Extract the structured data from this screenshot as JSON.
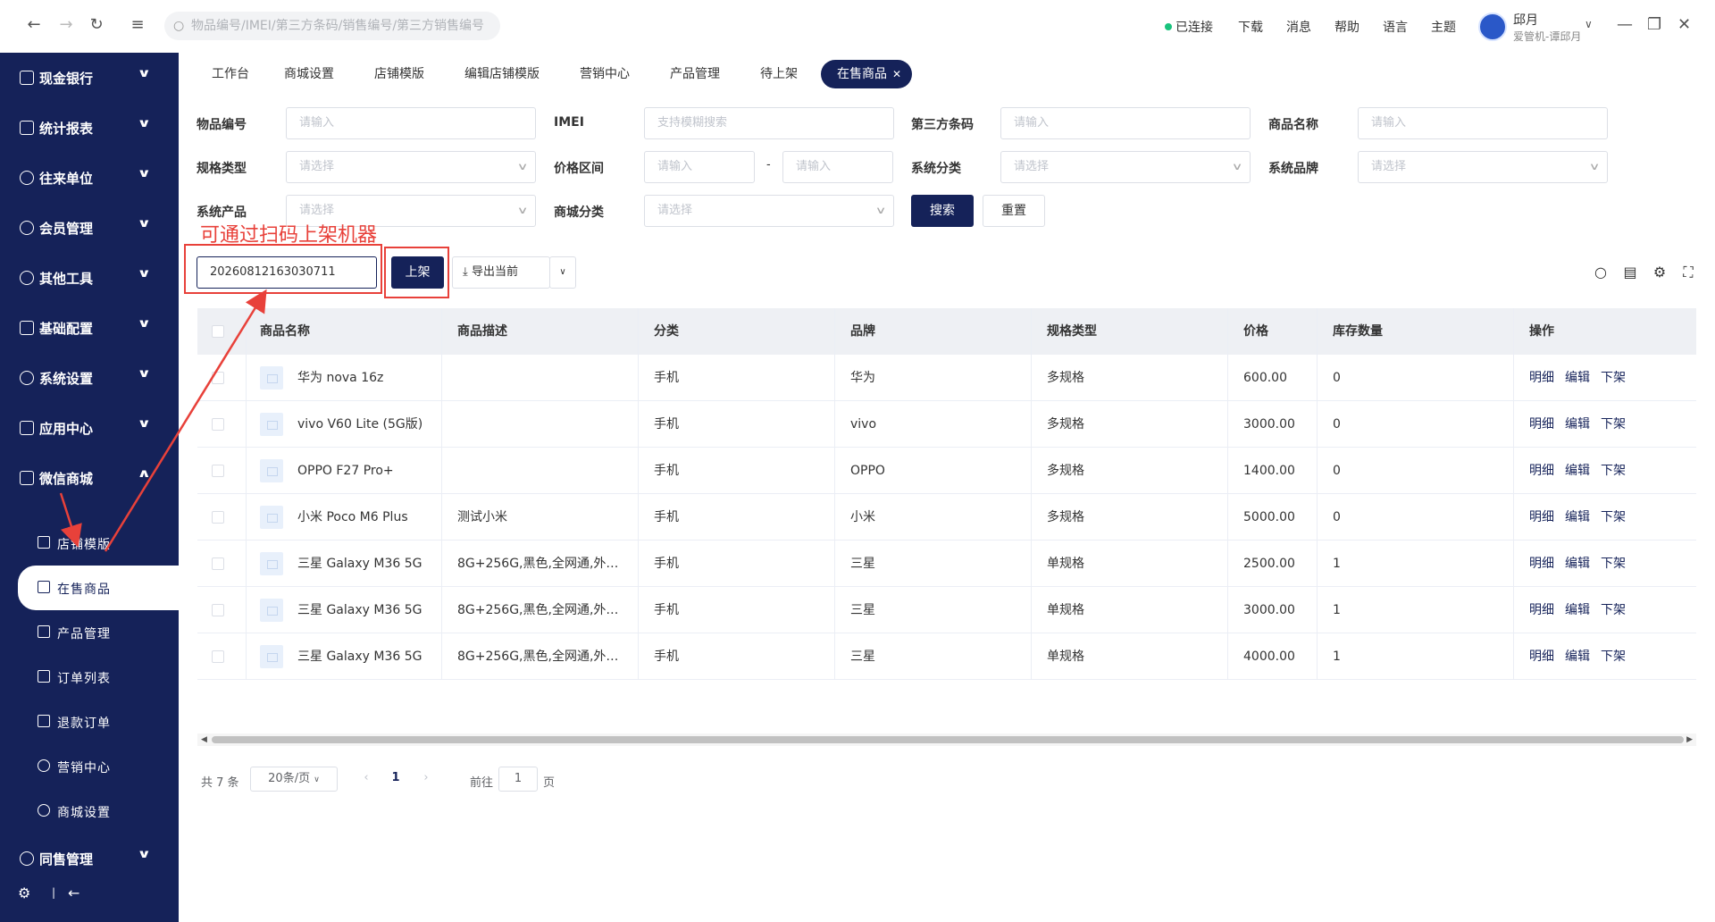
{
  "topbar": {
    "search_placeholder": "物品编号/IMEI/第三方条码/销售编号/第三方销售编号",
    "status": "已连接",
    "links": [
      "下载",
      "消息",
      "帮助",
      "语言",
      "主题"
    ],
    "user_name": "邱月",
    "user_sub": "爱管机-谭邱月"
  },
  "sidebar": {
    "menus": [
      {
        "label": "现金银行"
      },
      {
        "label": "统计报表"
      },
      {
        "label": "往来单位"
      },
      {
        "label": "会员管理"
      },
      {
        "label": "其他工具"
      },
      {
        "label": "基础配置"
      },
      {
        "label": "系统设置"
      },
      {
        "label": "应用中心"
      },
      {
        "label": "微信商城"
      }
    ],
    "submenus": [
      {
        "label": "店铺模版"
      },
      {
        "label": "在售商品"
      },
      {
        "label": "产品管理"
      },
      {
        "label": "订单列表"
      },
      {
        "label": "退款订单"
      },
      {
        "label": "营销中心"
      },
      {
        "label": "商城设置"
      }
    ],
    "last_menu": "同售管理"
  },
  "tabs": [
    "工作台",
    "商城设置",
    "店铺模版",
    "编辑店铺模版",
    "营销中心",
    "产品管理",
    "待上架",
    "在售商品"
  ],
  "filters": {
    "item_no_label": "物品编号",
    "item_no_ph": "请输入",
    "imei_label": "IMEI",
    "imei_ph": "支持模糊搜索",
    "barcode_label": "第三方条码",
    "barcode_ph": "请输入",
    "name_label": "商品名称",
    "name_ph": "请输入",
    "spec_label": "规格类型",
    "spec_ph": "请选择",
    "price_label": "价格区间",
    "price_min_ph": "请输入",
    "price_sep": "-",
    "price_max_ph": "请输入",
    "cat_label": "系统分类",
    "cat_ph": "请选择",
    "brand_label": "系统品牌",
    "brand_ph": "请选择",
    "product_label": "系统产品",
    "product_ph": "请选择",
    "mall_cat_label": "商城分类",
    "mall_cat_ph": "请选择",
    "search_btn": "搜索",
    "reset_btn": "重置"
  },
  "annotation": "可通过扫码上架机器",
  "actions": {
    "scan_value": "20260812163030711",
    "shelve_btn": "上架",
    "export_btn": "导出当前"
  },
  "table": {
    "headers": [
      "商品名称",
      "商品描述",
      "分类",
      "品牌",
      "规格类型",
      "价格",
      "库存数量",
      "操作"
    ],
    "rows": [
      {
        "name": "华为 nova 16z",
        "desc": "",
        "cat": "手机",
        "brand": "华为",
        "spec": "多规格",
        "price": "600.00",
        "stock": "0"
      },
      {
        "name": "vivo V60 Lite (5G版)",
        "desc": "",
        "cat": "手机",
        "brand": "vivo",
        "spec": "多规格",
        "price": "3000.00",
        "stock": "0"
      },
      {
        "name": "OPPO F27 Pro+",
        "desc": "",
        "cat": "手机",
        "brand": "OPPO",
        "spec": "多规格",
        "price": "1400.00",
        "stock": "0"
      },
      {
        "name": "小米 Poco M6 Plus",
        "desc": "测试小米",
        "cat": "手机",
        "brand": "小米",
        "spec": "多规格",
        "price": "5000.00",
        "stock": "0"
      },
      {
        "name": "三星 Galaxy M36 5G",
        "desc": "8G+256G,黑色,全网通,外版...",
        "cat": "手机",
        "brand": "三星",
        "spec": "单规格",
        "price": "2500.00",
        "stock": "1"
      },
      {
        "name": "三星 Galaxy M36 5G",
        "desc": "8G+256G,黑色,全网通,外版...",
        "cat": "手机",
        "brand": "三星",
        "spec": "单规格",
        "price": "3000.00",
        "stock": "1"
      },
      {
        "name": "三星 Galaxy M36 5G",
        "desc": "8G+256G,黑色,全网通,外版...",
        "cat": "手机",
        "brand": "三星",
        "spec": "单规格",
        "price": "4000.00",
        "stock": "1"
      }
    ],
    "ops": [
      "明细",
      "编辑",
      "下架"
    ]
  },
  "pager": {
    "total": "共 7 条",
    "page_size": "20条/页",
    "current": "1",
    "goto_label": "前往",
    "goto_value": "1",
    "page_unit": "页"
  },
  "colors": {
    "primary": "#152259",
    "annotation": "#e8413a",
    "connected": "#19c37d"
  }
}
